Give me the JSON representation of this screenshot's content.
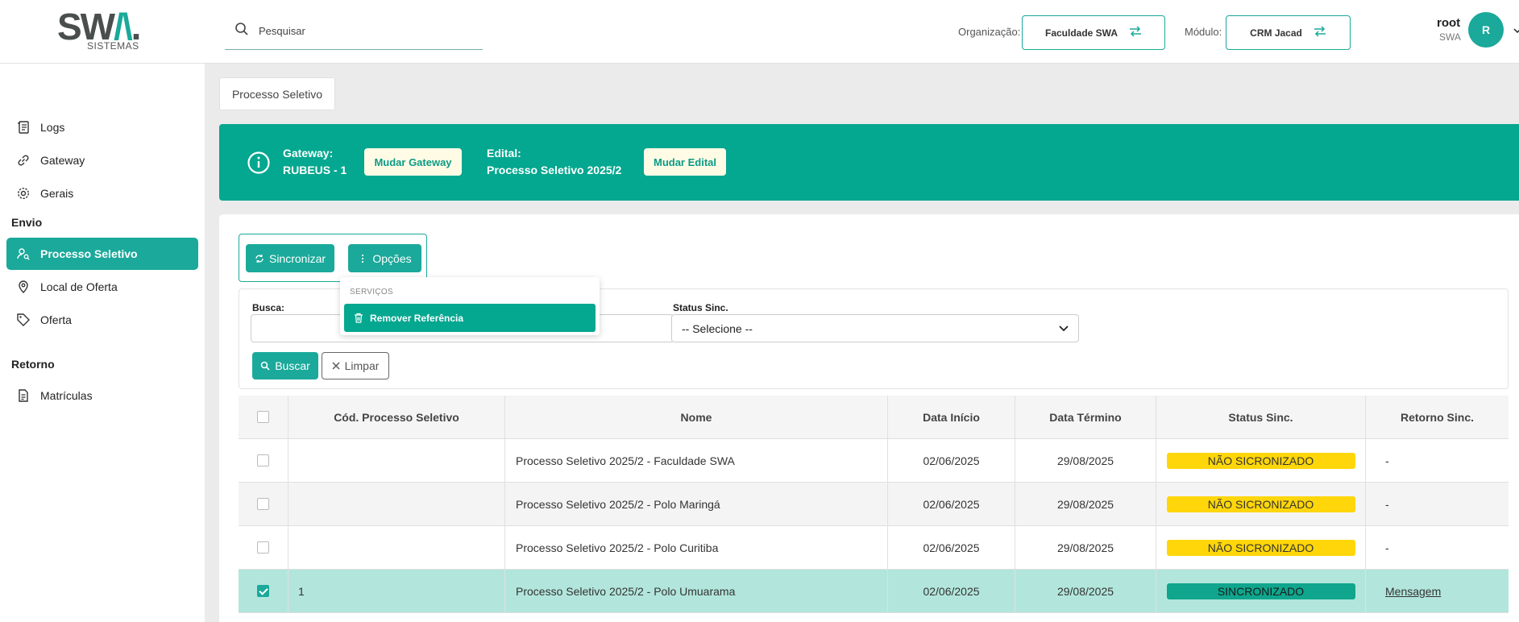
{
  "brand": {
    "logo_text": "SWA.",
    "logo_sub": "SISTEMAS",
    "accent": "#1aa99a"
  },
  "header": {
    "search_placeholder": "Pesquisar",
    "org_label": "Organização:",
    "org_value": "Faculdade SWA",
    "module_label": "Módulo:",
    "module_value": "CRM Jacad",
    "user_name": "root",
    "user_org": "SWA",
    "avatar_initial": "R"
  },
  "sidebar": {
    "items_top": [
      {
        "label": "Logs",
        "icon": "logs-icon"
      },
      {
        "label": "Gateway",
        "icon": "link-icon"
      },
      {
        "label": "Gerais",
        "icon": "gear-icon"
      }
    ],
    "section_envio": "Envio",
    "items_envio": [
      {
        "label": "Processo Seletivo",
        "icon": "user-search-icon",
        "active": true
      },
      {
        "label": "Local de Oferta",
        "icon": "map-pin-icon"
      },
      {
        "label": "Oferta",
        "icon": "tag-icon"
      }
    ],
    "section_retorno": "Retorno",
    "items_retorno": [
      {
        "label": "Matrículas",
        "icon": "document-icon"
      }
    ]
  },
  "breadcrumb": "Processo Seletivo",
  "banner": {
    "gateway_label": "Gateway:",
    "gateway_value": "RUBEUS - 1",
    "change_gateway": "Mudar Gateway",
    "edital_label": "Edital:",
    "edital_value": "Processo Seletivo 2025/2",
    "change_edital": "Mudar Edital"
  },
  "actions": {
    "sync": "Sincronizar",
    "options": "Opções"
  },
  "dropdown": {
    "section": "SERVIÇOS",
    "item": "Remover Referência"
  },
  "filters": {
    "busca_label": "Busca:",
    "status_label": "Status Sinc.",
    "status_value": "-- Selecione --",
    "search_btn": "Buscar",
    "clear_btn": "Limpar"
  },
  "table": {
    "headers": [
      "Cód. Processo Seletivo",
      "Nome",
      "Data Início",
      "Data Término",
      "Status Sinc.",
      "Retorno Sinc."
    ],
    "rows": [
      {
        "code": "",
        "name": "Processo Seletivo 2025/2 - Faculdade SWA",
        "start": "02/06/2025",
        "end": "29/08/2025",
        "status": "NÃO SICRONIZADO",
        "ret": "-"
      },
      {
        "code": "",
        "name": "Processo Seletivo 2025/2 - Polo Maringá",
        "start": "02/06/2025",
        "end": "29/08/2025",
        "status": "NÃO SICRONIZADO",
        "ret": "-"
      },
      {
        "code": "",
        "name": "Processo Seletivo 2025/2 - Polo Curitiba",
        "start": "02/06/2025",
        "end": "29/08/2025",
        "status": "NÃO SICRONIZADO",
        "ret": "-"
      },
      {
        "code": "1",
        "name": "Processo Seletivo 2025/2 - Polo Umuarama",
        "start": "02/06/2025",
        "end": "29/08/2025",
        "status": "SINCRONIZADO",
        "ret": "Mensagem"
      }
    ]
  }
}
